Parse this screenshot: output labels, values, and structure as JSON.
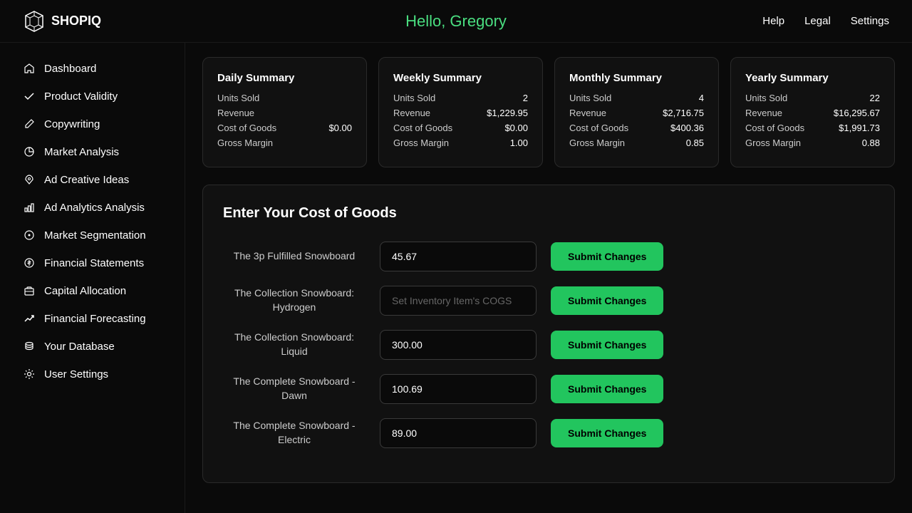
{
  "header": {
    "logo": "SHOPIQ",
    "greeting": "Hello, Gregory",
    "nav": [
      {
        "label": "Help",
        "id": "help"
      },
      {
        "label": "Legal",
        "id": "legal"
      },
      {
        "label": "Settings",
        "id": "settings"
      }
    ]
  },
  "sidebar": {
    "items": [
      {
        "id": "dashboard",
        "label": "Dashboard",
        "icon": "home"
      },
      {
        "id": "product-validity",
        "label": "Product Validity",
        "icon": "check"
      },
      {
        "id": "copywriting",
        "label": "Copywriting",
        "icon": "pencil"
      },
      {
        "id": "market-analysis",
        "label": "Market Analysis",
        "icon": "chart-pie"
      },
      {
        "id": "ad-creative-ideas",
        "label": "Ad Creative Ideas",
        "icon": "rocket"
      },
      {
        "id": "ad-analytics",
        "label": "Ad Analytics Analysis",
        "icon": "bar-chart"
      },
      {
        "id": "market-segmentation",
        "label": "Market Segmentation",
        "icon": "circle-dots"
      },
      {
        "id": "financial-statements",
        "label": "Financial Statements",
        "icon": "dollar"
      },
      {
        "id": "capital-allocation",
        "label": "Capital Allocation",
        "icon": "briefcase"
      },
      {
        "id": "financial-forecasting",
        "label": "Financial Forecasting",
        "icon": "trend-up"
      },
      {
        "id": "your-database",
        "label": "Your Database",
        "icon": "database"
      },
      {
        "id": "user-settings",
        "label": "User Settings",
        "icon": "gear"
      }
    ]
  },
  "summary_cards": [
    {
      "title": "Daily Summary",
      "rows": [
        {
          "label": "Units Sold",
          "value": ""
        },
        {
          "label": "Revenue",
          "value": ""
        },
        {
          "label": "Cost of Goods",
          "value": "$0.00"
        },
        {
          "label": "Gross Margin",
          "value": ""
        }
      ]
    },
    {
      "title": "Weekly Summary",
      "rows": [
        {
          "label": "Units Sold",
          "value": "2"
        },
        {
          "label": "Revenue",
          "value": "$1,229.95"
        },
        {
          "label": "Cost of Goods",
          "value": "$0.00"
        },
        {
          "label": "Gross Margin",
          "value": "1.00"
        }
      ]
    },
    {
      "title": "Monthly Summary",
      "rows": [
        {
          "label": "Units Sold",
          "value": "4"
        },
        {
          "label": "Revenue",
          "value": "$2,716.75"
        },
        {
          "label": "Cost of Goods",
          "value": "$400.36"
        },
        {
          "label": "Gross Margin",
          "value": "0.85"
        }
      ]
    },
    {
      "title": "Yearly Summary",
      "rows": [
        {
          "label": "Units Sold",
          "value": "22"
        },
        {
          "label": "Revenue",
          "value": "$16,295.67"
        },
        {
          "label": "Cost of Goods",
          "value": "$1,991.73"
        },
        {
          "label": "Gross Margin",
          "value": "0.88"
        }
      ]
    }
  ],
  "cogs": {
    "title": "Enter Your Cost of Goods",
    "submit_label": "Submit Changes",
    "items": [
      {
        "id": "3p-fulfilled",
        "name": "The 3p Fulfilled Snowboard",
        "value": "45.67",
        "placeholder": ""
      },
      {
        "id": "collection-hydrogen",
        "name": "The Collection Snowboard: Hydrogen",
        "value": "",
        "placeholder": "Set Inventory Item's COGS"
      },
      {
        "id": "collection-liquid",
        "name": "The Collection Snowboard: Liquid",
        "value": "300.00",
        "placeholder": ""
      },
      {
        "id": "complete-dawn",
        "name": "The Complete Snowboard - Dawn",
        "value": "100.69",
        "placeholder": ""
      },
      {
        "id": "complete-electric",
        "name": "The Complete Snowboard - Electric",
        "value": "89.00",
        "placeholder": ""
      }
    ]
  }
}
